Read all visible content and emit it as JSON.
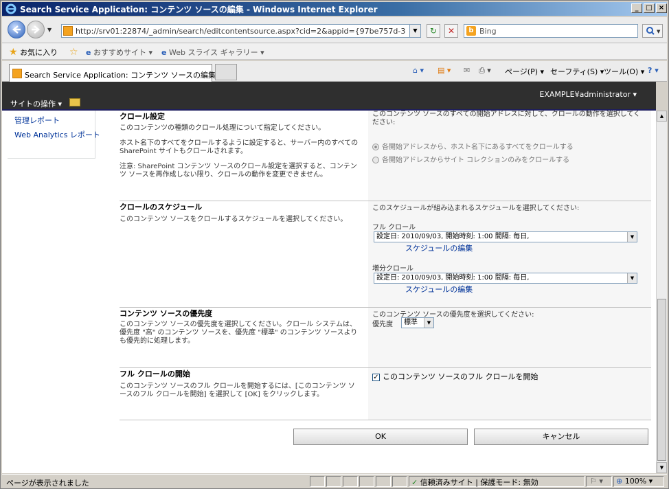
{
  "window": {
    "title": "Search Service Application: コンテンツ ソースの編集 - Windows Internet Explorer"
  },
  "address": {
    "url": "http://srv01:22874/_admin/search/editcontentsource.aspx?cid=2&appid={97be757d-3f94-4cde-t"
  },
  "search": {
    "placeholder": "Bing"
  },
  "favorites": {
    "favorites_label": "お気に入り",
    "suggested_sites": "おすすめサイト ▾",
    "web_slice_gallery": "Web スライス ギャラリー ▾"
  },
  "tab": {
    "title": "Search Service Application: コンテンツ ソースの編集"
  },
  "commands": {
    "page": "ページ(P) ▾",
    "safety": "セーフティ(S) ▾",
    "tools": "ツール(O) ▾"
  },
  "sharepoint": {
    "user": "EXAMPLE¥administrator ▾",
    "site_actions": "サイトの操作 ▾"
  },
  "leftnav": {
    "items": [
      "管理レポート",
      "Web Analytics レポート"
    ]
  },
  "sections": {
    "crawl_settings": {
      "heading": "クロール設定",
      "desc1": "このコンテンツの種類のクロール処理について指定してください。",
      "desc2": "ホスト名下のすべてをクロールするように設定すると、サーバー内のすべての SharePoint サイトもクロールされます。",
      "desc3": "注意: SharePoint コンテンツ ソースのクロール設定を選択すると、コンテンツ ソースを再作成しない限り、クロールの動作を変更できません。",
      "right_intro": "このコンテンツ ソースのすべての開始アドレスに対して、クロールの動作を選択してください:",
      "option1": "各開始アドレスから、ホスト名下にあるすべてをクロールする",
      "option2": "各開始アドレスからサイト コレクションのみをクロールする"
    },
    "crawl_schedule": {
      "heading": "クロールのスケジュール",
      "desc": "このコンテンツ ソースをクロールするスケジュールを選択してください。",
      "right_intro": "このスケジュールが組み込まれるスケジュールを選択してください:",
      "full_label": "フル クロール",
      "full_value": "設定日: 2010/09/03, 開始時刻: 1:00 間隔: 毎日,",
      "full_edit": "スケジュールの編集",
      "incr_label": "増分クロール",
      "incr_value": "設定日: 2010/09/03, 開始時刻: 1:00 間隔: 毎日,",
      "incr_edit": "スケジュールの編集"
    },
    "priority": {
      "heading": "コンテンツ ソースの優先度",
      "desc": "このコンテンツ ソースの優先度を選択してください。クロール システムは、優先度 \"高\" のコンテンツ ソースを、優先度 \"標準\" のコンテンツ ソースよりも優先的に処理します。",
      "right_intro": "このコンテンツ ソースの優先度を選択してください:",
      "label": "優先度",
      "value": "標準"
    },
    "full_crawl": {
      "heading": "フル クロールの開始",
      "desc": "このコンテンツ ソースのフル クロールを開始するには、[このコンテンツ ソースのフル クロールを開始] を選択して [OK] をクリックします。",
      "checkbox_label": "このコンテンツ ソースのフル クロールを開始"
    }
  },
  "buttons": {
    "ok": "OK",
    "cancel": "キャンセル"
  },
  "status": {
    "message": "ページが表示されました",
    "zone": "信頼済みサイト | 保護モード: 無効",
    "zoom": "100%"
  }
}
